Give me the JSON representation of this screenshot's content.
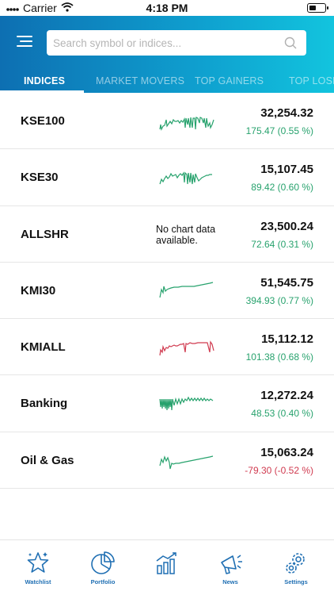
{
  "status_bar": {
    "carrier": "Carrier",
    "time": "4:18 PM"
  },
  "search": {
    "placeholder": "Search symbol or indices..."
  },
  "tabs": [
    {
      "label": "INDICES",
      "active": true
    },
    {
      "label": "MARKET MOVERS",
      "active": false
    },
    {
      "label": "TOP GAINERS",
      "active": false
    },
    {
      "label": "TOP LOSERS",
      "active": false
    }
  ],
  "colors": {
    "positive": "#27a26d",
    "negative": "#d03a4f",
    "accent": "#1f6fb3",
    "header_start": "#0d6fb2",
    "header_end": "#12c4de"
  },
  "indices": [
    {
      "name": "KSE100",
      "value": "32,254.32",
      "change": "175.47 (0.55 %)",
      "direction": "up",
      "chart": "available"
    },
    {
      "name": "KSE30",
      "value": "15,107.45",
      "change": "89.42 (0.60 %)",
      "direction": "up",
      "chart": "available"
    },
    {
      "name": "ALLSHR",
      "value": "23,500.24",
      "change": "72.64 (0.31 %)",
      "direction": "up",
      "no_chart_text": "No chart data available."
    },
    {
      "name": "KMI30",
      "value": "51,545.75",
      "change": "394.93 (0.77 %)",
      "direction": "up",
      "chart": "available"
    },
    {
      "name": "KMIALL",
      "value": "15,112.12",
      "change": "101.38 (0.68 %)",
      "direction": "up",
      "chart": "available"
    },
    {
      "name": "Banking",
      "value": "12,272.24",
      "change": "48.53 (0.40 %)",
      "direction": "up",
      "chart": "available"
    },
    {
      "name": "Oil & Gas",
      "value": "15,063.24",
      "change": "-79.30 (-0.52 %)",
      "direction": "down",
      "chart": "available"
    }
  ],
  "bottom_nav": [
    {
      "label": "Watchlist",
      "icon": "star-icon"
    },
    {
      "label": "Portfolio",
      "icon": "pie-chart-icon"
    },
    {
      "label": "",
      "icon": "bar-chart-icon"
    },
    {
      "label": "News",
      "icon": "megaphone-icon"
    },
    {
      "label": "Settings",
      "icon": "gear-icon"
    }
  ]
}
